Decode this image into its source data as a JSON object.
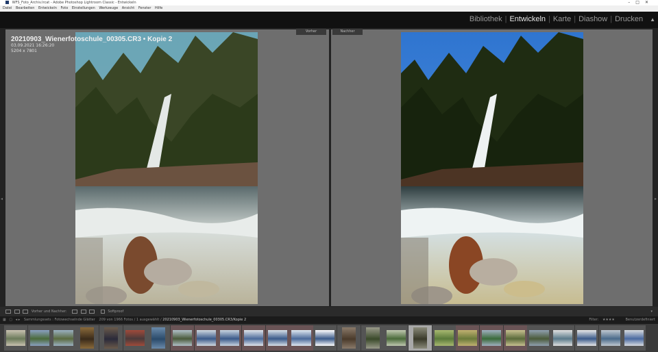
{
  "window": {
    "title": "WFS_Foto_Archiv.lrcat - Adobe Photoshop Lightroom Classic - Entwickeln"
  },
  "menu": {
    "items": [
      "Datei",
      "Bearbeiten",
      "Entwickeln",
      "Foto",
      "Einstellungen",
      "Werkzeuge",
      "Ansicht",
      "Fenster",
      "Hilfe"
    ]
  },
  "modules": {
    "items": [
      "Bibliothek",
      "Entwickeln",
      "Karte",
      "Diashow",
      "Drucken"
    ],
    "active": "Entwickeln"
  },
  "compare": {
    "before_label": "Vorher",
    "after_label": "Nachher"
  },
  "photo_info": {
    "filename": "20210903_Wienerfotoschule_00305.CR3  •  Kopie 2",
    "datetime": "03.09.2021 16:26:20",
    "dimensions": "5204 x 7801"
  },
  "toolbar": {
    "view_label": "Vorher und Nachher:",
    "softproof_label": "Softproof"
  },
  "filmstrip_header": {
    "source": "Sammlungssets : Fotowechselnde Glätter",
    "count": "209 von 1966 Fotos / 1 ausgewählt /",
    "selected_path": "20210903_Wienerfotoschule_00305.CR3/Kopie 2",
    "filter_label": "Filter:",
    "rating": "★★★★",
    "preset_label": "Benutzerdefiniert"
  },
  "colors": {
    "sky_before": "#6aa5b6",
    "sky_after": "#3a7fd2",
    "forest": "#2e3a1c",
    "water": "#c8d4d6",
    "rock": "#8a5a3c",
    "accent_active": "#e8e8e8"
  }
}
